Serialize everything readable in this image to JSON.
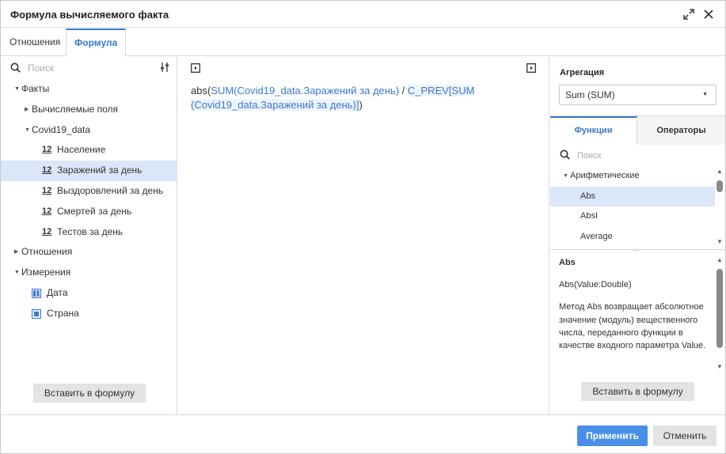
{
  "dialog": {
    "title": "Формула вычисляемого факта"
  },
  "tabs": [
    {
      "label": "Отношения"
    },
    {
      "label": "Формула"
    }
  ],
  "left": {
    "search_placeholder": "Поиск",
    "tree": {
      "facts": "Факты",
      "calculated_fields": "Вычисляемые поля",
      "covid": "Covid19_data",
      "num_icon": "12",
      "items": [
        {
          "label": "Население"
        },
        {
          "label": "Заражений за день"
        },
        {
          "label": "Выздоровлений за день"
        },
        {
          "label": "Смертей за день"
        },
        {
          "label": "Тестов за день"
        }
      ],
      "relations": "Отношения",
      "dimensions": "Измерения",
      "dim_items": [
        {
          "label": "Дата"
        },
        {
          "label": "Страна"
        }
      ]
    },
    "insert_button": "Вставить в формулу"
  },
  "formula": {
    "p1": "abs(",
    "p2": "SUM(Covid19_data.Заражений за день)",
    "p3": " / ",
    "p4": "C_PREV[SUM",
    "p5": "(Covid19_data.Заражений за день)]",
    "p6": ")"
  },
  "right": {
    "aggregation_label": "Агрегация",
    "aggregation_value": "Sum (SUM)",
    "tab_functions": "Функции",
    "tab_operators": "Операторы",
    "search_placeholder": "Поиск",
    "group": "Арифметические",
    "functions": [
      {
        "label": "Abs"
      },
      {
        "label": "AbsI"
      },
      {
        "label": "Average"
      }
    ],
    "desc_title": "Abs",
    "desc_signature": "Abs(Value:Double)",
    "desc_text": "Метод Abs возвращает абсолютное значение (модуль) вещественного числа, переданного функции в качестве входного параметра Value.",
    "insert_button": "Вставить в формулу"
  },
  "footer": {
    "apply": "Применить",
    "cancel": "Отменить"
  },
  "colors": {
    "accent": "#3a78d0",
    "primary_button": "#4a8fe7",
    "selection": "#dbe7f8"
  }
}
